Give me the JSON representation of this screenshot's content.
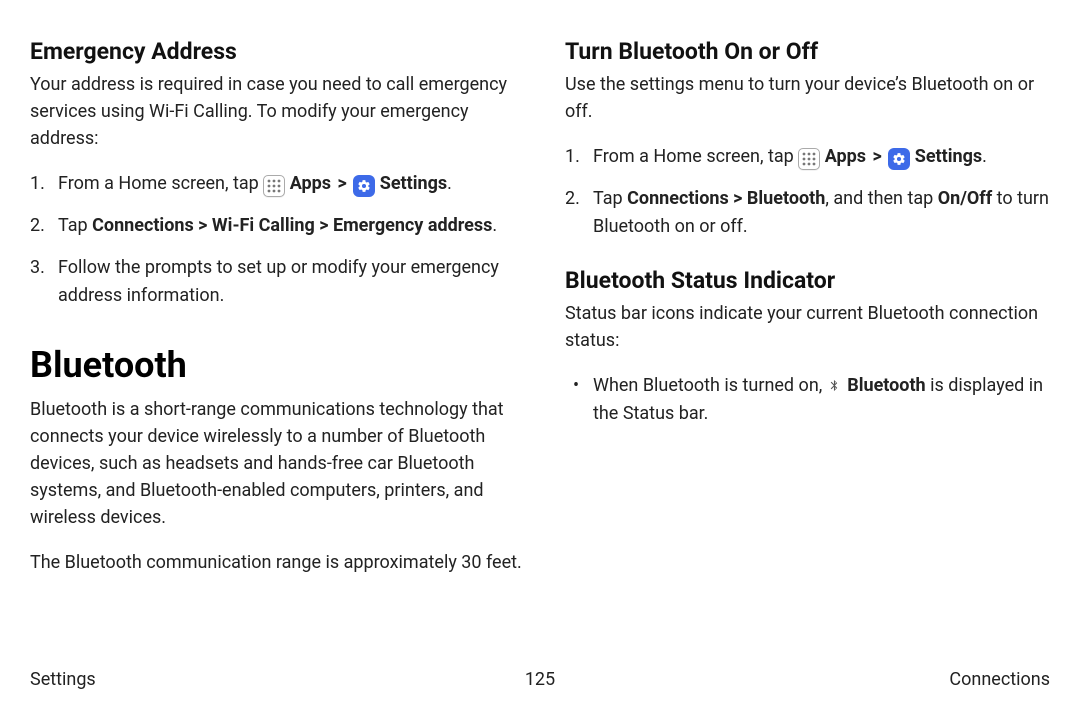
{
  "left": {
    "h_emergency": "Emergency Address",
    "p_emergency": "Your address is required in case you need to call emergency services using Wi-Fi Calling. To modify your emergency address:",
    "steps_emergency": {
      "s1_pre": "From a Home screen, tap ",
      "apps_label": "Apps",
      "chev": ">",
      "settings_label": "Settings",
      "period": ".",
      "s2_pre": "Tap ",
      "s2_bold": "Connections > Wi-Fi Calling > Emergency address",
      "s2_post": ".",
      "s3": "Follow the prompts to set up or modify your emergency address information."
    },
    "h_bluetooth": "Bluetooth",
    "p_bt1": "Bluetooth is a short-range communications technology that connects your device wirelessly to a number of Bluetooth devices, such as headsets and hands-free car Bluetooth systems, and Bluetooth-enabled computers, printers, and wireless devices.",
    "p_bt2": "The Bluetooth communication range is approximately 30 feet."
  },
  "right": {
    "h_turn": "Turn Bluetooth On or Off",
    "p_turn": "Use the settings menu to turn your device’s Bluetooth on or off.",
    "steps_turn": {
      "s1_pre": "From a Home screen, tap ",
      "apps_label": "Apps",
      "chev": ">",
      "settings_label": "Settings",
      "period": ".",
      "s2_pre": "Tap ",
      "s2_bold1": "Connections > Bluetooth",
      "s2_mid": ", and then tap ",
      "s2_bold2": "On/Off",
      "s2_post": " to turn Bluetooth on or off."
    },
    "h_status": "Bluetooth Status Indicator",
    "p_status": "Status bar icons indicate your current Bluetooth connection status:",
    "bullet": {
      "pre": "When Bluetooth is turned on, ",
      "bt_label": "Bluetooth",
      "post": " is displayed in the Status bar."
    }
  },
  "footer": {
    "left": "Settings",
    "page": "125",
    "right": "Connections"
  }
}
